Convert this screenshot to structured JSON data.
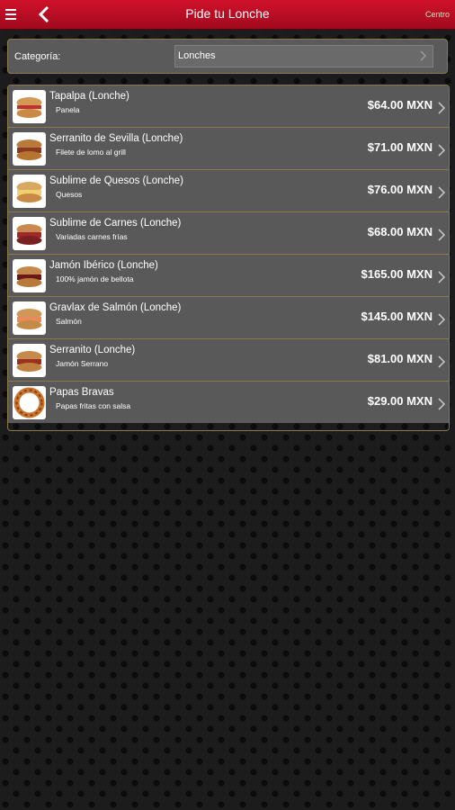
{
  "header": {
    "title": "Pide tu Lonche",
    "right_label": "Centro"
  },
  "category": {
    "label": "Categoría:",
    "selected": "Lonches"
  },
  "items": [
    {
      "name": "Tapalpa (Lonche)",
      "desc": "Panela",
      "price": "$64.00 MXN",
      "icon": "sandwich-icon"
    },
    {
      "name": "Serranito de Sevilla (Lonche)",
      "desc": "Filete de lomo al grill",
      "price": "$71.00 MXN",
      "icon": "sandwich-icon"
    },
    {
      "name": "Sublime de Quesos (Lonche)",
      "desc": "Quesos",
      "price": "$76.00 MXN",
      "icon": "sandwich-icon"
    },
    {
      "name": "Sublime de Carnes (Lonche)",
      "desc": "Variadas carnes frías",
      "price": "$68.00 MXN",
      "icon": "sandwich-icon"
    },
    {
      "name": "Jamón Ibérico (Lonche)",
      "desc": "100% jamón de bellota",
      "price": "$165.00 MXN",
      "icon": "sandwich-icon"
    },
    {
      "name": "Gravlax de Salmón (Lonche)",
      "desc": "Salmón",
      "price": "$145.00 MXN",
      "icon": "sandwich-icon"
    },
    {
      "name": "Serranito (Lonche)",
      "desc": "Jamón Serrano",
      "price": "$81.00 MXN",
      "icon": "sandwich-icon"
    },
    {
      "name": "Papas Bravas",
      "desc": "Papas fritas con salsa",
      "price": "$29.00 MXN",
      "icon": "fries-icon"
    }
  ]
}
